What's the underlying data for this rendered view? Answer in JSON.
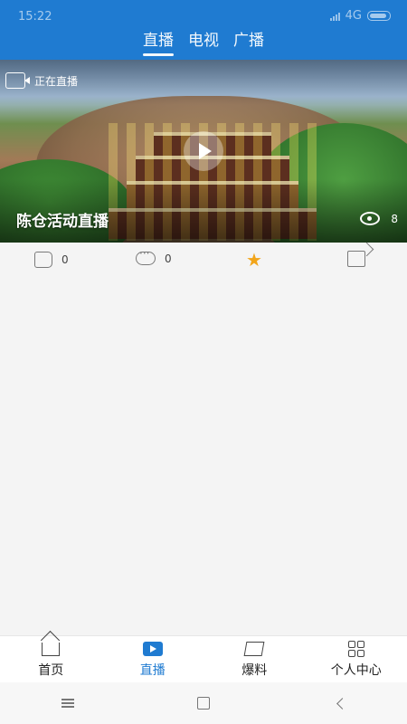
{
  "status_bar": {
    "time": "15:22",
    "network": "4G"
  },
  "top_tabs": {
    "items": [
      "直播",
      "电视",
      "广播"
    ],
    "active_index": 0
  },
  "live": {
    "badge_text": "正在直播",
    "title": "陈仓活动直播",
    "view_count": "8"
  },
  "actions": {
    "like_count": "0",
    "comment_count": "0",
    "colors": {
      "star": "#f2a51a"
    }
  },
  "bottom_nav": {
    "items": [
      {
        "label": "首页",
        "icon": "home-icon"
      },
      {
        "label": "直播",
        "icon": "live-icon"
      },
      {
        "label": "爆料",
        "icon": "diamond-icon"
      },
      {
        "label": "个人中心",
        "icon": "grid-icon"
      }
    ],
    "active_index": 1,
    "colors": {
      "accent": "#1f7bd1"
    }
  },
  "system_nav": {
    "items": [
      "menu-icon",
      "home-square-icon",
      "back-icon"
    ]
  }
}
